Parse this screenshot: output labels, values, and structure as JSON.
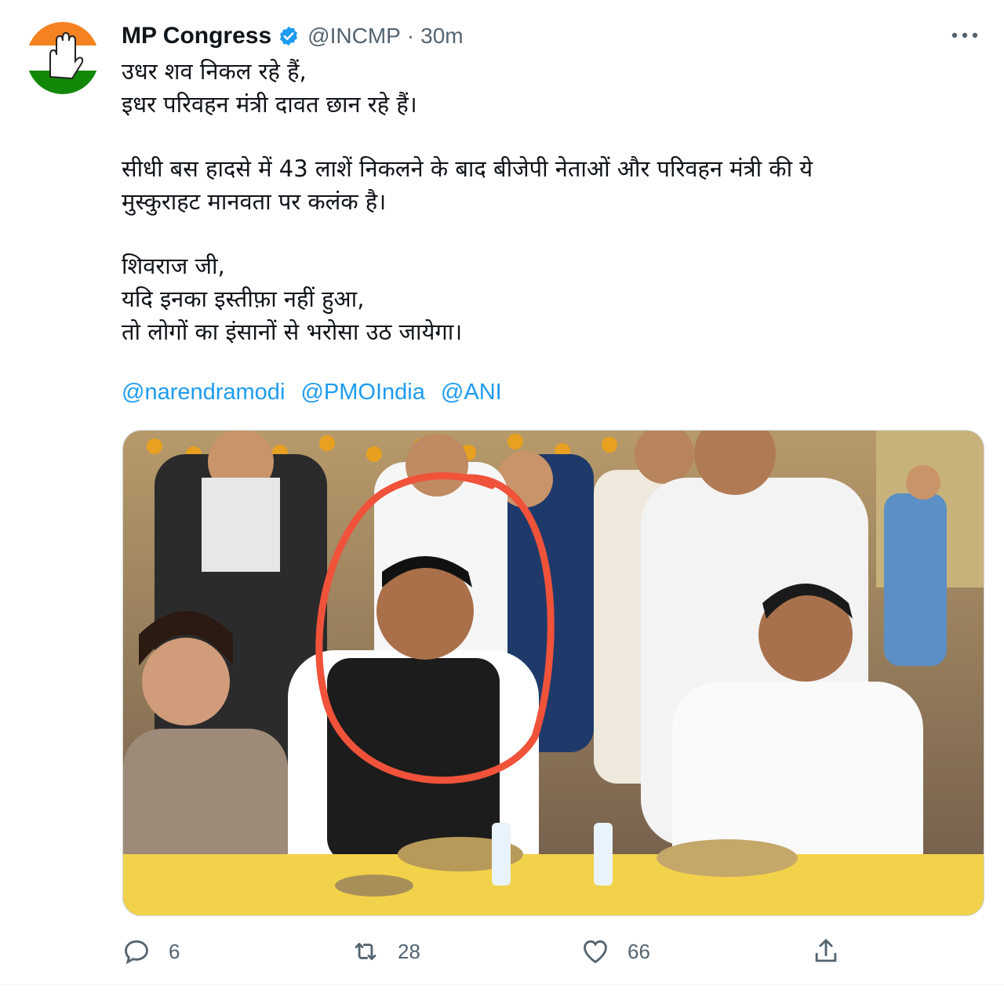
{
  "tweet": {
    "author_name": "MP Congress",
    "handle": "@INCMP",
    "separator": "·",
    "time": "30m",
    "body_lines": [
      "उधर शव निकल रहे हैं,",
      "इधर परिवहन मंत्री दावत छान रहे हैं।",
      "सीधी बस हादसे में 43 लाशें निकलने के बाद बीजेपी नेताओं और परिवहन मंत्री की ये",
      "मुस्कुराहट मानवता पर कलंक है।",
      "शिवराज जी,",
      "यदि इनका इस्तीफ़ा नहीं हुआ,",
      "तो लोगों का इंसानों से भरोसा उठ जायेगा।"
    ],
    "mentions": [
      "@narendramodi",
      "@PMOIndia",
      "@ANI"
    ],
    "actions": {
      "reply_count": "6",
      "retweet_count": "28",
      "like_count": "66"
    }
  },
  "icons": {
    "avatar": "congress-hand-logo-icon",
    "verified": "verified-badge-icon",
    "more": "more-options-icon",
    "reply": "reply-icon",
    "retweet": "retweet-icon",
    "like": "heart-icon",
    "share": "share-icon"
  },
  "colors": {
    "text": "#0f1419",
    "secondary": "#536471",
    "link": "#1d9bf0",
    "verified": "#1d9bf0",
    "saffron": "#f58220",
    "green": "#138808",
    "highlight_circle": "#f0523a"
  }
}
